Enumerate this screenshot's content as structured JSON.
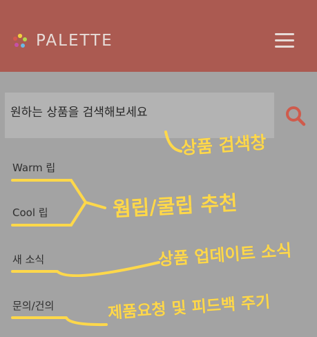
{
  "brand": {
    "name": "PALETTE",
    "logo_icon": "palette-dots-icon",
    "logo_colors": [
      "#f1cf3f",
      "#b6d64a",
      "#6cb8e3",
      "#c64fa7",
      "#d5584e"
    ]
  },
  "header": {
    "menu_icon": "hamburger-menu-icon",
    "background_color": "#ab5a51"
  },
  "search": {
    "placeholder": "원하는 상품을 검색해보세요",
    "button_icon": "search-icon",
    "icon_color": "#cf5b4c"
  },
  "nav": {
    "items": [
      {
        "label": "Warm 립"
      },
      {
        "label": "Cool 립"
      },
      {
        "label": "새 소식"
      },
      {
        "label": "문의/건의"
      }
    ]
  },
  "annotations": {
    "search_note": "상품 검색창",
    "recommend_note": "웜립/쿨립 추천",
    "news_note": "상품 업데이트 소식",
    "feedback_note": "제품요청 및 피드백 주기",
    "color": "#ffd84a"
  }
}
